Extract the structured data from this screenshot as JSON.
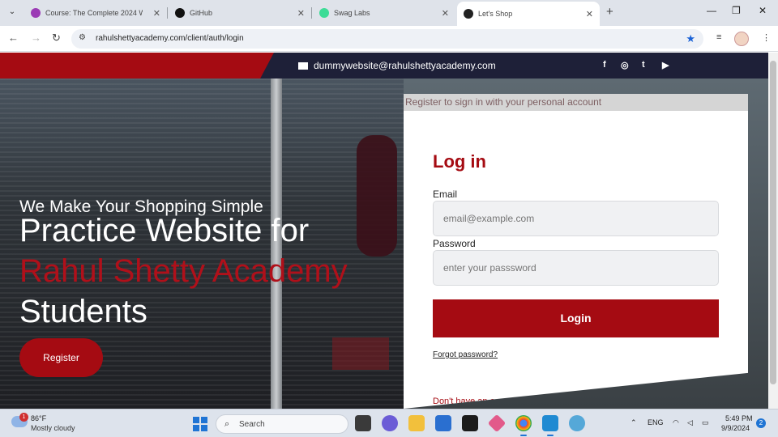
{
  "browser": {
    "tabs": [
      {
        "title": "Course: The Complete 2024 W",
        "icon": "course-favicon",
        "color": "#9b3bb5"
      },
      {
        "title": "GitHub",
        "icon": "github-icon",
        "color": "#111111"
      },
      {
        "title": "Swag Labs",
        "icon": "swaglabs-favicon",
        "color": "#3ddc97"
      },
      {
        "title": "Let's Shop",
        "icon": "angular-favicon",
        "color": "#222222"
      }
    ],
    "active_tab": 3,
    "new_tab": "+",
    "url": "rahulshettyacademy.com/client/auth/login"
  },
  "site": {
    "email": "dummywebsite@rahulshettyacademy.com",
    "social": [
      "f",
      "◎",
      "t",
      "▶"
    ],
    "hero": {
      "subtitle": "We Make Your Shopping Simple",
      "line1": "Practice Website for",
      "line2": "Rahul Shetty Academy",
      "line3": "Students",
      "register_label": "Register"
    },
    "card": {
      "header": "Register to sign in with your personal account",
      "title": "Log in",
      "email_label": "Email",
      "email_placeholder": "email@example.com",
      "password_label": "Password",
      "password_placeholder": "enter your passsword",
      "login_label": "Login",
      "forgot_label": "Forgot password?",
      "no_account": "Don't have an acc..."
    }
  },
  "taskbar": {
    "weather_temp": "86°F",
    "weather_desc": "Mostly cloudy",
    "weather_badge": "1",
    "search_label": "Search",
    "lang": "ENG",
    "time": "5:49 PM",
    "date": "9/9/2024",
    "notifications": "2"
  },
  "colors": {
    "brand_red": "#a50b12",
    "navy": "#1e2038"
  }
}
